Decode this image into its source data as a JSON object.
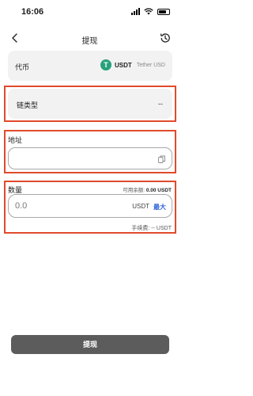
{
  "status_bar": {
    "time": "16:06"
  },
  "header": {
    "title": "提现"
  },
  "coin": {
    "label": "代币",
    "symbol": "USDT",
    "name": "Tether USD",
    "icon_letter": "T"
  },
  "chain": {
    "label": "链类型",
    "value": "--"
  },
  "address": {
    "label": "地址",
    "value": ""
  },
  "quantity": {
    "label": "数量",
    "available_label": "可用余额:",
    "available_value": "0.00 USDT",
    "placeholder": "0.0",
    "unit": "USDT",
    "max_label": "最大",
    "fee_label": "手续费:",
    "fee_value": "-- USDT"
  },
  "actions": {
    "withdraw_label": "提现"
  },
  "colors": {
    "highlight": "#e04b2c",
    "tether": "#26a17b",
    "max_link": "#2e62d9",
    "button": "#5c5c5c"
  }
}
